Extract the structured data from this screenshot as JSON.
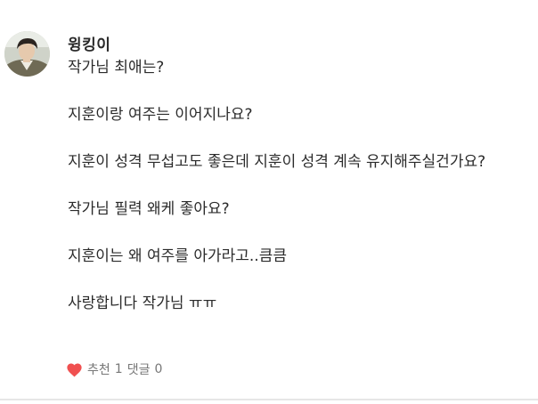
{
  "comment": {
    "author": "윙킹이",
    "avatar_icon": "user-avatar",
    "lines": [
      "작가님 최애는?",
      "지훈이랑 여주는 이어지나요?",
      "지훈이 성격 무섭고도 좋은데 지훈이 성격 계속 유지해주실건가요?",
      "작가님 필력 왜케 좋아요?",
      "지훈이는 왜 여주를 아가라고..큼큼",
      "사랑합니다 작가님 ㅠㅠ"
    ],
    "like_icon": "heart-icon",
    "like_color": "#f05050",
    "like_label": "추천",
    "like_count": "1",
    "reply_label": "댓글",
    "reply_count": "0"
  }
}
